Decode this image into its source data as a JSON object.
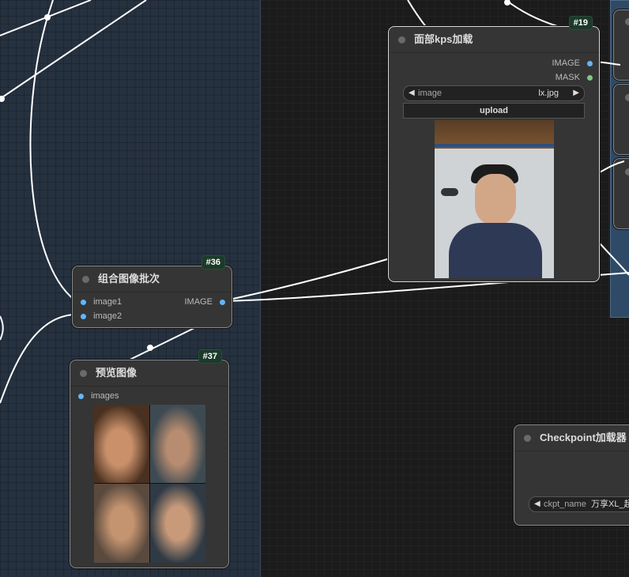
{
  "nodes": {
    "face_kps": {
      "title": "面部kps加载",
      "badge": "#19",
      "outputs": [
        "IMAGE",
        "MASK"
      ],
      "image_widget": {
        "label": "image",
        "value": "lx.jpg"
      },
      "upload_label": "upload"
    },
    "batch": {
      "title": "组合图像批次",
      "badge": "#36",
      "inputs": [
        "image1",
        "image2"
      ],
      "output": "IMAGE"
    },
    "preview": {
      "title": "预览图像",
      "badge": "#37",
      "input": "images"
    },
    "checkpoint": {
      "title": "Checkpoint加载器",
      "widget": {
        "label": "ckpt_name",
        "value": "万享XL_超"
      }
    }
  },
  "colors": {
    "link": "#ffffff",
    "image_slot": "#64b5f6",
    "mask_slot": "#81c784",
    "badge_bg": "#1b3a2a",
    "group_bg": "#25313f"
  }
}
